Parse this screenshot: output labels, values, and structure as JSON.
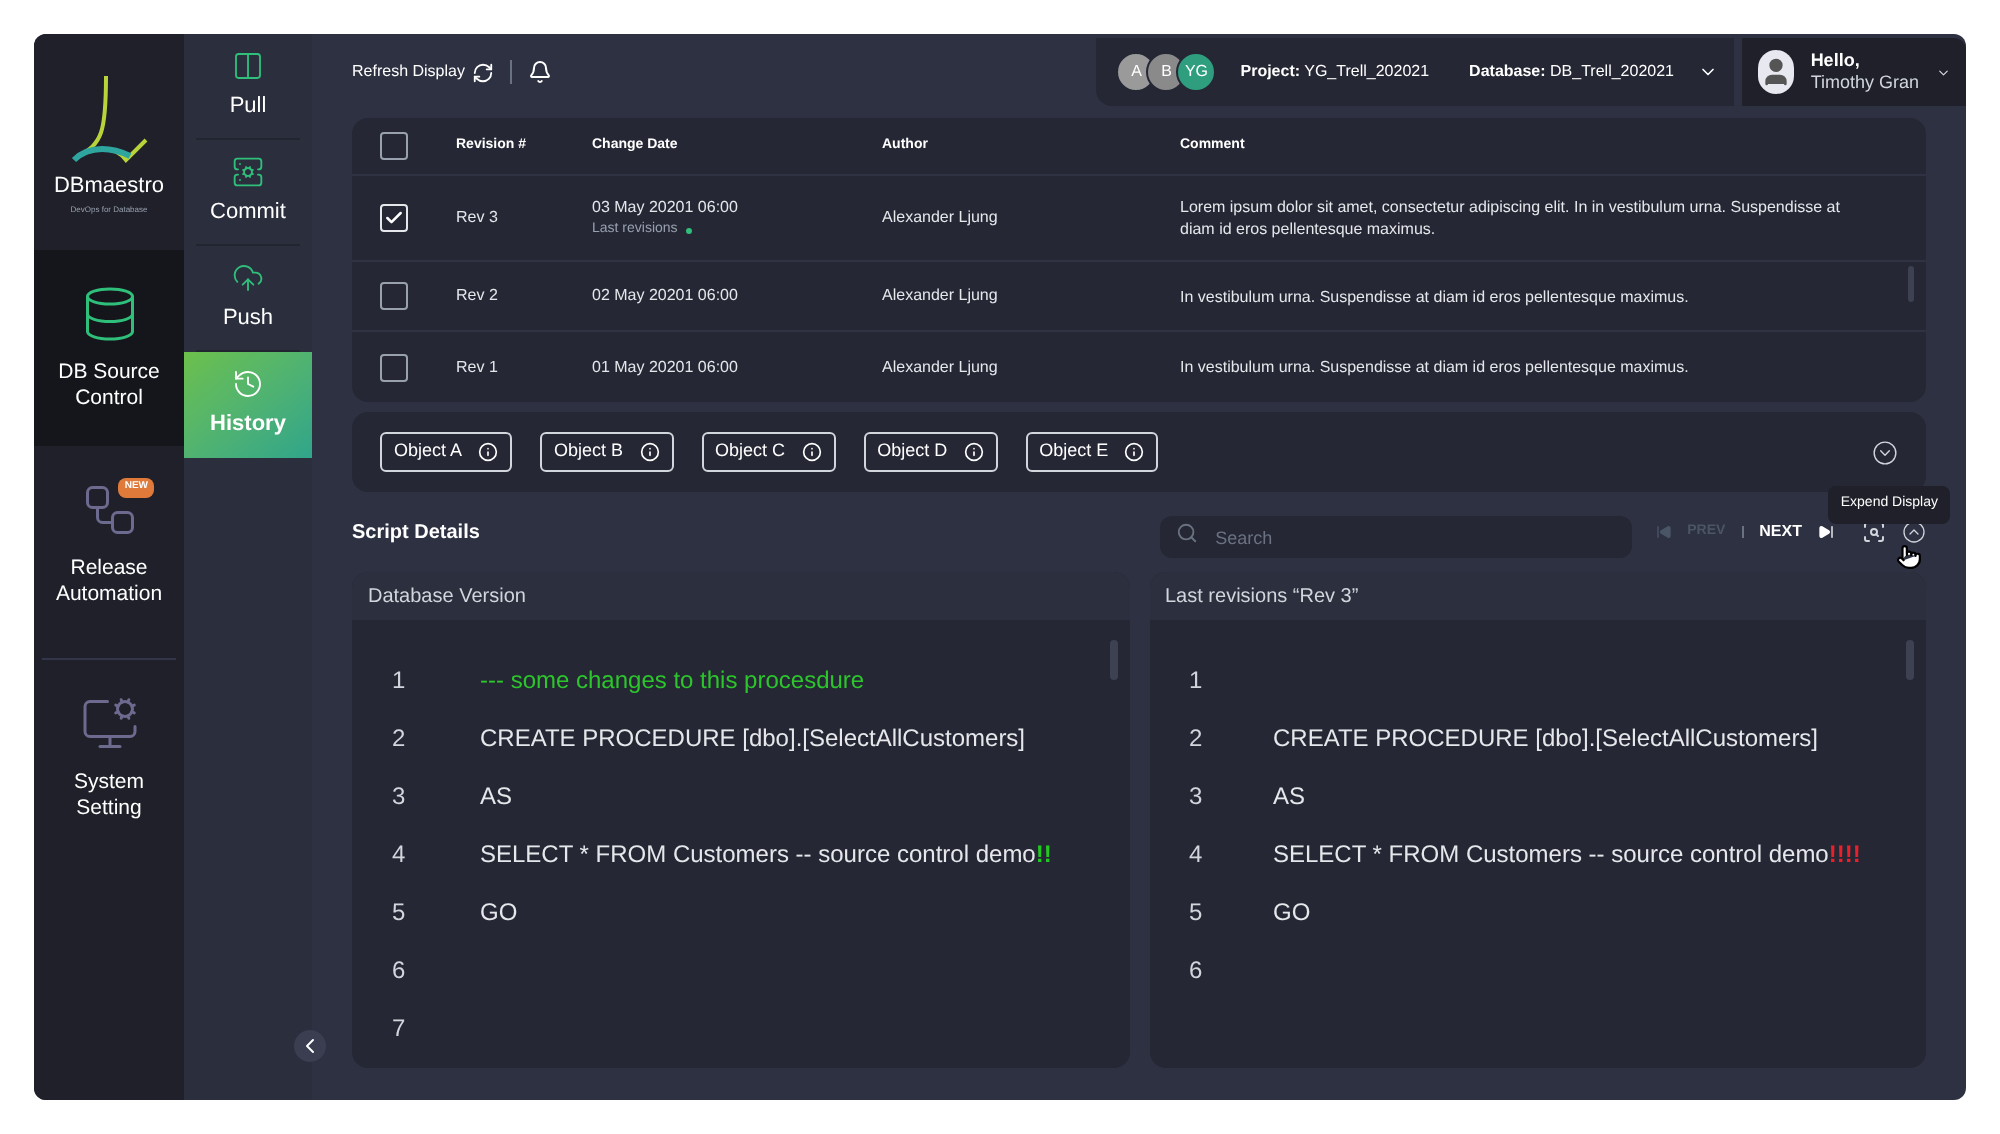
{
  "brand": {
    "name": "DBmaestro",
    "tagline": "DevOps for Database"
  },
  "nav": [
    {
      "label": "DB Source Control",
      "selected": true
    },
    {
      "label": "Release Automation",
      "selected": false,
      "badge": "NEW"
    },
    {
      "label": "System Setting",
      "selected": false
    }
  ],
  "subnav": [
    {
      "label": "Pull",
      "selected": false
    },
    {
      "label": "Commit",
      "selected": false
    },
    {
      "label": "Push",
      "selected": false
    },
    {
      "label": "History",
      "selected": true
    }
  ],
  "topbar": {
    "refresh": "Refresh Display",
    "avatars": [
      {
        "initials": "A",
        "color": "#9a9a9a"
      },
      {
        "initials": "B",
        "color": "#8a8a8a"
      },
      {
        "initials": "YG",
        "color": "#2e9e7e"
      }
    ],
    "project_label": "Project:",
    "project": "YG_Trell_202021",
    "database_label": "Database:",
    "database": "DB_Trell_202021",
    "greeting": "Hello,",
    "user": "Timothy Gran"
  },
  "table": {
    "header_checked": false,
    "columns": [
      "Revision #",
      "Change Date",
      "Author",
      "Comment"
    ],
    "rows": [
      {
        "checked": true,
        "revision": "Rev 3",
        "date": "03 May 20201 06:00",
        "note": "Last revisions",
        "author": "Alexander Ljung",
        "comment": "Lorem ipsum dolor sit amet, consectetur adipiscing elit. In in vestibulum urna. Suspendisse at diam id eros pellentesque maximus."
      },
      {
        "checked": false,
        "revision": "Rev 2",
        "date": "02 May 20201 06:00",
        "author": "Alexander Ljung",
        "comment": "In vestibulum urna. Suspendisse at diam id eros pellentesque maximus."
      },
      {
        "checked": false,
        "revision": "Rev 1",
        "date": "01 May 20201 06:00",
        "author": "Alexander Ljung",
        "comment": "In vestibulum urna. Suspendisse at diam id eros pellentesque maximus."
      }
    ]
  },
  "objects": [
    "Object A",
    "Object B",
    "Object C",
    "Object D",
    "Object E"
  ],
  "script": {
    "title": "Script Details",
    "search_placeholder": "Search",
    "prev": "PREV",
    "next": "NEXT",
    "tooltip": "Expend Display",
    "panes": [
      {
        "title": "Database Version",
        "numbers": [
          "1",
          "2",
          "3",
          "4",
          "5",
          "6",
          "7"
        ],
        "offset": false,
        "lines": [
          {
            "text": "--- some changes to this procesdure",
            "comment": true
          },
          {
            "text": "CREATE PROCEDURE [dbo].[SelectAllCustomers]",
            "comment": false
          },
          {
            "text": "AS",
            "comment": false
          },
          {
            "text": "SELECT * FROM Customers -- source control demo",
            "comment": false,
            "mark": "!!",
            "color": "#22c722"
          },
          {
            "text": "GO",
            "comment": false
          }
        ]
      },
      {
        "title": "Last revisions “Rev 3”",
        "numbers": [
          "1",
          "2",
          "3",
          "4",
          "5",
          "6"
        ],
        "offset": true,
        "lines": [
          {
            "text": "CREATE PROCEDURE [dbo].[SelectAllCustomers]",
            "comment": false
          },
          {
            "text": "AS",
            "comment": false
          },
          {
            "text": "SELECT * FROM Customers -- source control demo",
            "comment": false,
            "mark": "!!!!",
            "color": "#e8202a"
          },
          {
            "text": "GO",
            "comment": false
          }
        ]
      }
    ]
  }
}
